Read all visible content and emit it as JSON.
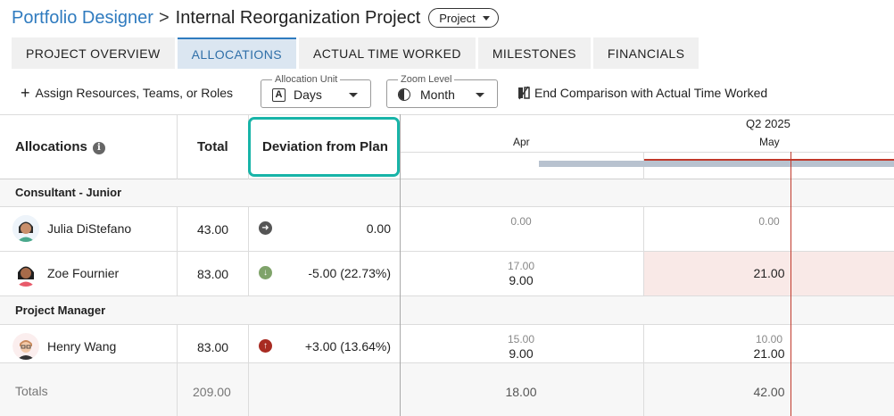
{
  "header": {
    "breadcrumb_link": "Portfolio Designer",
    "separator": ">",
    "title": "Internal Reorganization Project",
    "type_pill": "Project"
  },
  "tabs": [
    {
      "label": "PROJECT OVERVIEW",
      "active": false
    },
    {
      "label": "ALLOCATIONS",
      "active": true
    },
    {
      "label": "ACTUAL TIME WORKED",
      "active": false
    },
    {
      "label": "MILESTONES",
      "active": false
    },
    {
      "label": "FINANCIALS",
      "active": false
    }
  ],
  "toolbar": {
    "assign_label": "Assign Resources, Teams, or Roles",
    "allocation_unit": {
      "legend": "Allocation Unit",
      "value": "Days"
    },
    "zoom_level": {
      "legend": "Zoom Level",
      "value": "Month"
    },
    "end_comparison_label": "End Comparison with Actual Time Worked"
  },
  "grid": {
    "col_allocations": "Allocations",
    "col_total": "Total",
    "col_deviation": "Deviation from Plan",
    "quarter": "Q2 2025",
    "months": [
      "Apr",
      "May"
    ],
    "sections": [
      {
        "name": "Consultant - Junior",
        "rows": [
          {
            "name": "Julia DiStefano",
            "total": "43.00",
            "deviation": "0.00",
            "trend": "neutral",
            "apr_plan": "0.00",
            "apr_actual": "",
            "may_plan": "0.00",
            "may_actual": ""
          },
          {
            "name": "Zoe Fournier",
            "total": "83.00",
            "deviation": "-5.00 (22.73%)",
            "trend": "down",
            "apr_plan": "17.00",
            "apr_actual": "9.00",
            "may_plan": "",
            "may_actual": "21.00"
          }
        ]
      },
      {
        "name": "Project Manager",
        "rows": [
          {
            "name": "Henry Wang",
            "total": "83.00",
            "deviation": "+3.00 (13.64%)",
            "trend": "up",
            "apr_plan": "15.00",
            "apr_actual": "9.00",
            "may_plan": "10.00",
            "may_actual": "21.00"
          }
        ]
      }
    ],
    "totals": {
      "label": "Totals",
      "total": "209.00",
      "apr": "18.00",
      "may": "42.00"
    }
  },
  "colors": {
    "accent": "#2f7bbf",
    "highlight": "#18b4a8",
    "today_line": "#c0392b",
    "over_cell": "#f9e9e7",
    "trend_neutral": "#555555",
    "trend_down": "#7fa36a",
    "trend_up": "#a82b22"
  },
  "icons": [
    "plus-icon",
    "calendar-a-icon",
    "half-moon-icon",
    "compare-icon",
    "info-icon",
    "arrow-right-icon",
    "arrow-down-icon",
    "arrow-up-icon"
  ]
}
